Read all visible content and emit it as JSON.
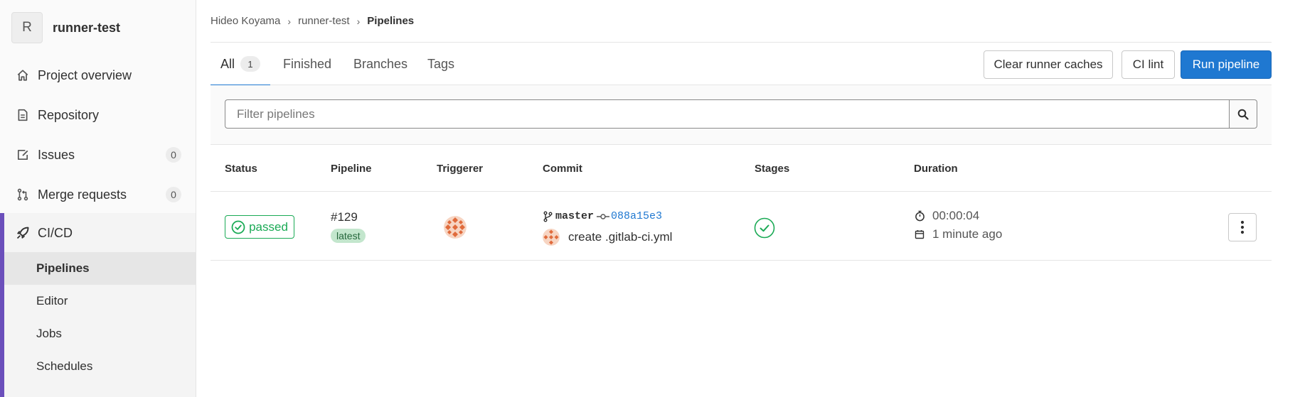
{
  "project": {
    "avatar_letter": "R",
    "name": "runner-test"
  },
  "sidebar": {
    "items": [
      {
        "label": "Project overview",
        "icon": "home-icon"
      },
      {
        "label": "Repository",
        "icon": "document-icon"
      },
      {
        "label": "Issues",
        "icon": "issues-icon",
        "count": "0"
      },
      {
        "label": "Merge requests",
        "icon": "merge-request-icon",
        "count": "0"
      }
    ],
    "cicd": {
      "label": "CI/CD",
      "icon": "rocket-icon",
      "subitems": [
        {
          "label": "Pipelines",
          "active": true
        },
        {
          "label": "Editor"
        },
        {
          "label": "Jobs"
        },
        {
          "label": "Schedules"
        }
      ]
    }
  },
  "breadcrumb": [
    "Hideo Koyama",
    "runner-test",
    "Pipelines"
  ],
  "tabs": [
    {
      "label": "All",
      "count": "1",
      "active": true
    },
    {
      "label": "Finished"
    },
    {
      "label": "Branches"
    },
    {
      "label": "Tags"
    }
  ],
  "actions": {
    "clear_caches": "Clear runner caches",
    "ci_lint": "CI lint",
    "run_pipeline": "Run pipeline"
  },
  "filter": {
    "placeholder": "Filter pipelines"
  },
  "table": {
    "headers": [
      "Status",
      "Pipeline",
      "Triggerer",
      "Commit",
      "Stages",
      "Duration"
    ],
    "rows": [
      {
        "status": "passed",
        "pipeline_id": "#129",
        "pipeline_tag": "latest",
        "branch": "master",
        "sha": "088a15e3",
        "commit_title": "create .gitlab-ci.yml",
        "duration": "00:00:04",
        "finished": "1 minute ago"
      }
    ]
  },
  "colors": {
    "primary": "#1f78d1",
    "success": "#1aaa55",
    "sidebar_accent": "#6b4fbb"
  }
}
